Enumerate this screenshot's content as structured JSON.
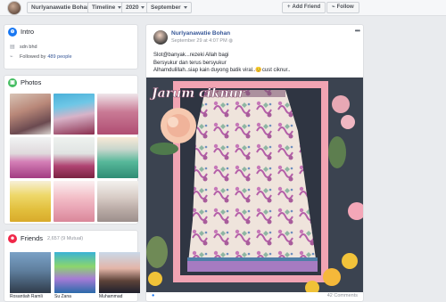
{
  "topbar": {
    "profile_name": "Nurlyanawatie Bohan",
    "timeline_label": "Timeline",
    "year_label": "2020",
    "month_label": "September",
    "add_friend_label": "Add Friend",
    "follow_label": "Follow"
  },
  "intro": {
    "title": "Intro",
    "location": "sdn bhd",
    "followed_prefix": "Followed by",
    "followed_count": "489 people"
  },
  "photos": {
    "title": "Photos"
  },
  "friends": {
    "title": "Friends",
    "count": "2,657 (9 Mutual)",
    "items": [
      {
        "name": "Rosantiah Ramli"
      },
      {
        "name": "Su Zana"
      },
      {
        "name": "Muhammad"
      }
    ]
  },
  "post": {
    "author": "Nurlyanawatie Bohan",
    "timestamp": "September 29 at 4:07 PM",
    "more_icon": "more-icon",
    "line1": "Slot@banyak...rezeki Allah bagi",
    "line2": "Bersyukur dan terus bersyukur",
    "line3": "Alhamdulillah..siap kain duyong batik viral..😊cust ciknur..",
    "image_caption": "Jarum ciknur",
    "footer_comments": "42 Comments"
  },
  "colors": {
    "link": "#385898",
    "intro_icon": "#1877f2",
    "photos_icon": "#45bd62",
    "friends_icon": "#f02849"
  }
}
